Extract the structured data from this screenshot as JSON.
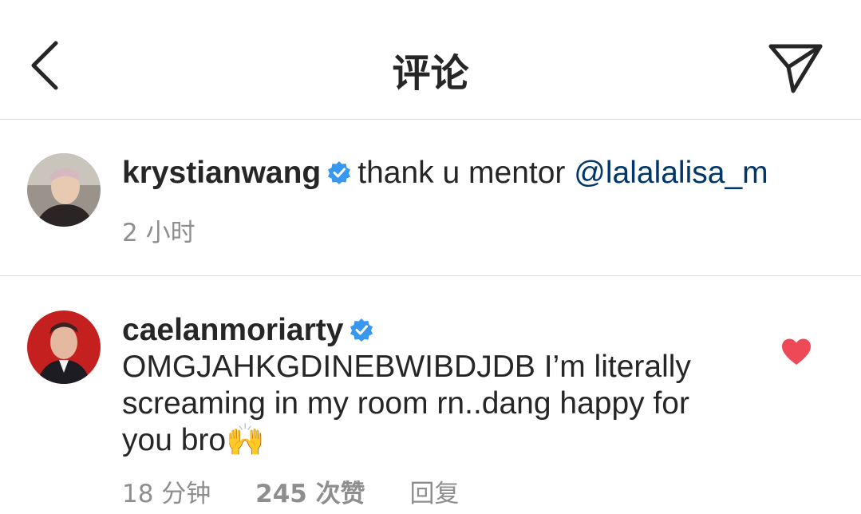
{
  "header": {
    "title": "评论",
    "back_icon": "chevron-left-icon",
    "send_icon": "paper-plane-icon"
  },
  "caption": {
    "username": "krystianwang",
    "verified": true,
    "text": "thank u mentor",
    "mention": "@lalalalisa_m",
    "time": "2 小时"
  },
  "comment": {
    "username": "caelanmoriarty",
    "verified": true,
    "text": "OMGJAHKGDINEBWIBDJDB I’m literally screaming in my room rn..dang happy for you bro",
    "emoji": "🙌",
    "time": "18 分钟",
    "likes": "245 次赞",
    "reply_label": "回复",
    "liked": true
  },
  "colors": {
    "text": "#262626",
    "secondary": "#8e8e8e",
    "mention": "#00376b",
    "verified_blue": "#3897f0",
    "like_red": "#ed4956",
    "divider": "#dbdbdb"
  }
}
